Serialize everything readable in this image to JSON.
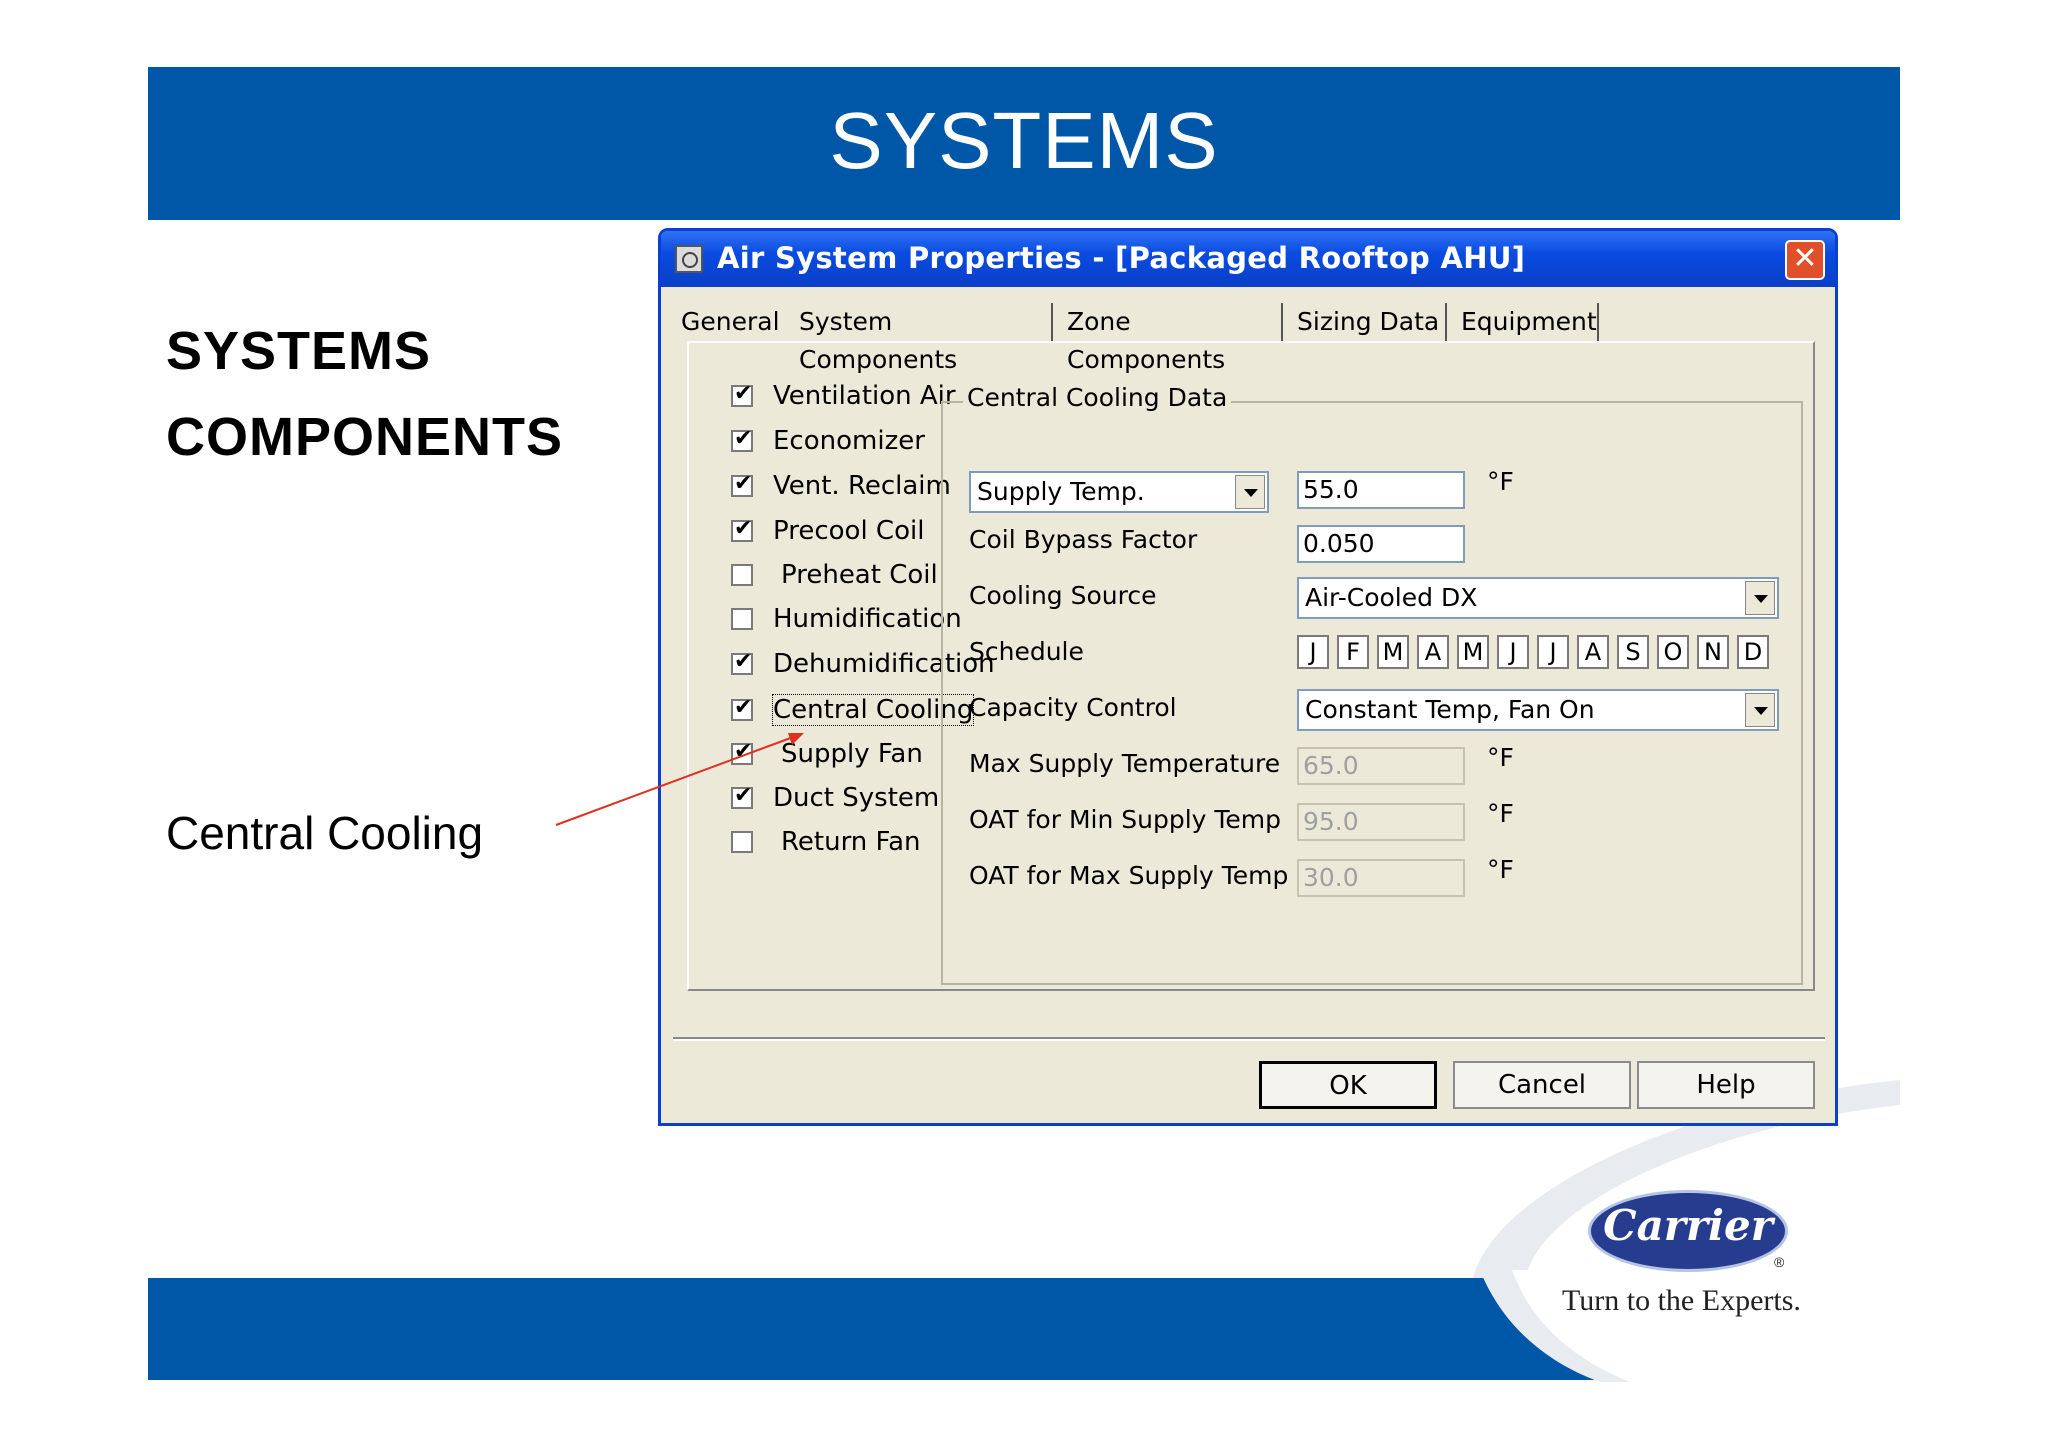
{
  "slide": {
    "title": "SYSTEMS",
    "heading_line1": "SYSTEMS",
    "heading_line2": "COMPONENTS",
    "callout": "Central Cooling"
  },
  "dialog": {
    "title": "Air System Properties - [Packaged Rooftop AHU]",
    "close_icon": "close-icon",
    "tabs": [
      "General",
      "System Components",
      "Zone Components",
      "Sizing Data",
      "Equipment"
    ],
    "active_tab": "System Components",
    "components": [
      {
        "label": "Ventilation Air",
        "checked": true
      },
      {
        "label": "Economizer",
        "checked": true
      },
      {
        "label": "Vent. Reclaim",
        "checked": true
      },
      {
        "label": "Precool Coil",
        "checked": true
      },
      {
        "label": "Preheat Coil",
        "checked": false
      },
      {
        "label": "Humidification",
        "checked": false
      },
      {
        "label": "Dehumidification",
        "checked": true
      },
      {
        "label": "Central Cooling",
        "checked": true
      },
      {
        "label": "Supply Fan",
        "checked": true
      },
      {
        "label": "Duct System",
        "checked": true
      },
      {
        "label": "Return Fan",
        "checked": false
      }
    ],
    "group_title": "Central Cooling Data",
    "supply_temp_select": "Supply Temp.",
    "supply_temp_value": "55.0",
    "unit_f": "°F",
    "coil_bypass_label": "Coil Bypass Factor",
    "coil_bypass_value": "0.050",
    "cooling_source_label": "Cooling Source",
    "cooling_source_value": "Air-Cooled DX",
    "schedule_label": "Schedule",
    "months": [
      "J",
      "F",
      "M",
      "A",
      "M",
      "J",
      "J",
      "A",
      "S",
      "O",
      "N",
      "D"
    ],
    "capacity_control_label": "Capacity Control",
    "capacity_control_value": "Constant Temp, Fan On",
    "max_supply_label": "Max Supply Temperature",
    "max_supply_value": "65.0",
    "oat_min_label": "OAT for Min Supply Temp",
    "oat_min_value": "95.0",
    "oat_max_label": "OAT for Max Supply Temp",
    "oat_max_value": "30.0",
    "buttons": {
      "ok": "OK",
      "cancel": "Cancel",
      "help": "Help"
    }
  },
  "brand": {
    "logo_text": "Carrier",
    "registered": "®",
    "tagline": "Turn to the Experts."
  },
  "colors": {
    "banner": "#0057a8",
    "titlebar": "#0a4be0",
    "dialog_bg": "#ece9d8",
    "arrow": "#e03020"
  }
}
